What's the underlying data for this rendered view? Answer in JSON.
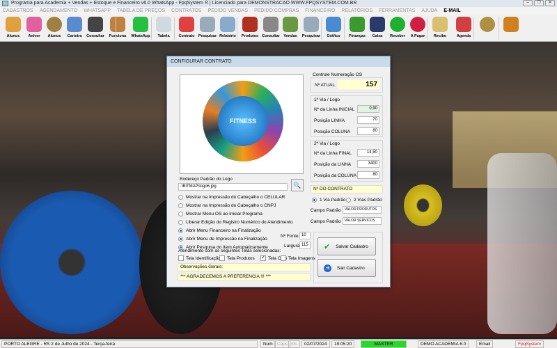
{
  "window": {
    "title": "Programa para Academia + Vendas + Estoque e Financeiro v6.0 WhatsApp - FpqSystem ® | Licenciado para  DEMONSTRACAO WWW.FPQSYSTEM.COM.BR"
  },
  "menu": [
    "CADASTROS",
    "AGENDAMENTO",
    "WHATSAPP",
    "TABELA DE PREÇOS",
    "CONTRATOS",
    "PEDIDO VENDAS",
    "PEDIDO COMPRAS",
    "FINANCEIRO",
    "RELATÓRIOS",
    "FERRAMENTAS",
    "AJUDA"
  ],
  "menu_email": "E-MAIL",
  "toolbar": [
    {
      "label": "Alunos",
      "icon": "students-icon",
      "color": "#e0a040"
    },
    {
      "label": "Aniver",
      "icon": "cake-icon",
      "color": "#e060a0"
    },
    {
      "label": "Alunos",
      "icon": "coin-icon",
      "color": "#a08040"
    },
    {
      "label": "Carteira",
      "icon": "id-card-icon",
      "color": "#5a8ad0"
    },
    {
      "label": "Consultar",
      "icon": "id-search-icon",
      "color": "#444"
    },
    {
      "label": "Funciona",
      "icon": "employee-icon",
      "color": "#c08040"
    },
    {
      "label": "WhatsApp",
      "icon": "whatsapp-icon",
      "color": "#25c040"
    },
    {
      "label": "Tabela",
      "icon": "table-icon",
      "color": "#d0d8e0"
    },
    {
      "label": "Contrato",
      "icon": "contract-icon",
      "color": "#e04040"
    },
    {
      "label": "Pesquisar",
      "icon": "search-doc-icon",
      "color": "#9ab"
    },
    {
      "label": "Relatório",
      "icon": "printer-icon",
      "color": "#8ac"
    },
    {
      "label": "Produtos",
      "icon": "cart-products-icon",
      "color": "#b03020"
    },
    {
      "label": "Consultar",
      "icon": "barcode-icon",
      "color": "#888"
    },
    {
      "label": "Vendas",
      "icon": "sales-cart-icon",
      "color": "#6a9a40"
    },
    {
      "label": "Pesquisar",
      "icon": "search-doc-icon",
      "color": "#9ab"
    },
    {
      "label": "Gráfico",
      "icon": "chart-icon",
      "color": "#4a8ad0"
    },
    {
      "label": "Finanças",
      "icon": "finance-icon",
      "color": "#3a9a30"
    },
    {
      "label": "Caixa",
      "icon": "cashbook-icon",
      "color": "#2a3a6a"
    },
    {
      "label": "Receber",
      "icon": "receive-icon",
      "color": "#20b030"
    },
    {
      "label": "A Pagar",
      "icon": "pay-icon",
      "color": "#d02040"
    },
    {
      "label": "Recibo",
      "icon": "receipt-icon",
      "color": "#d8c070"
    },
    {
      "label": "Agenda",
      "icon": "calendar-icon",
      "color": "#d04040"
    },
    {
      "label": "",
      "icon": "coins-icon",
      "color": "#b09040"
    },
    {
      "label": "",
      "icon": "exit-icon",
      "color": "#d08020"
    }
  ],
  "dialog": {
    "title": "CONFIGURAR CONTRATO",
    "logo_text": "FITNESS",
    "logo_path_label": "Endereço Padrão do Logo",
    "logo_path": ".\\BITMAP\\logo6.jpg",
    "options": [
      {
        "label": "Mostrar na Impressão do Cabeçalho o CELULAR",
        "checked": false
      },
      {
        "label": "Mostrar na Impressão do Cabeçalho o CNPJ",
        "checked": false
      },
      {
        "label": "Mostrar Menu OS ao Iniciar Programa",
        "checked": false
      },
      {
        "label": "Liberar Edição do Registro Numérico do Atendimento",
        "checked": false
      },
      {
        "label": "Abrir Menu Financeiro na Finalização",
        "checked": true
      },
      {
        "label": "Abrir Menu de Impressão na Finalização",
        "checked": true
      },
      {
        "label": "Abrir Pesquisa do Item Automaticamente",
        "checked": true
      }
    ],
    "fonte_label": "Nº Fonte",
    "fonte": "10",
    "largura_label": "Largura",
    "largura": "115",
    "telas_label": "Atendimento com as seguintes Telas selecionadas:",
    "telas": [
      {
        "label": "Tela Identificação",
        "checked": false
      },
      {
        "label": "Tela Produtos",
        "checked": false
      },
      {
        "label": "Tela OBS",
        "checked": true
      },
      {
        "label": "Tela Imagens",
        "checked": false
      }
    ],
    "obs_label": "Observações Gerais:",
    "obs_text": "*** AGRADECEMOS A PREFERENCIA !!! ***",
    "controle_label": "Controle Numeração OS",
    "atual_label": "Nº ATUAL",
    "atual": "157",
    "via1_label": "1ª Via / Logo",
    "via1": [
      {
        "label": "Nº da Linha INICIAL",
        "value": "0,90"
      },
      {
        "label": "Posição LINHA",
        "value": "70"
      },
      {
        "label": "Posição COLUNA",
        "value": "80"
      }
    ],
    "via2_label": "2ª Via / Logo",
    "via2": [
      {
        "label": "Nº da Linha FINAL",
        "value": "14,50"
      },
      {
        "label": "Posição da LINHA",
        "value": "3400"
      },
      {
        "label": "Posição da COLUNA",
        "value": "80"
      }
    ],
    "contrato_label": "Nº DO CONTRATO",
    "via_padrao": "1 Via Padrão",
    "vias_padrao": "2 Vias Padrão",
    "campo_label": "Campo Padrão",
    "campo1": "VALOR PRODUTOS",
    "campo2": "VALOR SERVICOS",
    "save": "Salvar Cadastro",
    "exit": "Sair Cadastro"
  },
  "status": {
    "location": "PORTO ALEGRE - RS  2 de Julho de 2024 - Terça-feira",
    "num": "Num",
    "caps": "Caps",
    "ins": "Ins",
    "date": "02/07/2024",
    "time": "19:05:20",
    "user": "MASTER",
    "company": "DEMO ACADEMIA 6.0",
    "email": "Email",
    "brand": "FpqSystem"
  }
}
